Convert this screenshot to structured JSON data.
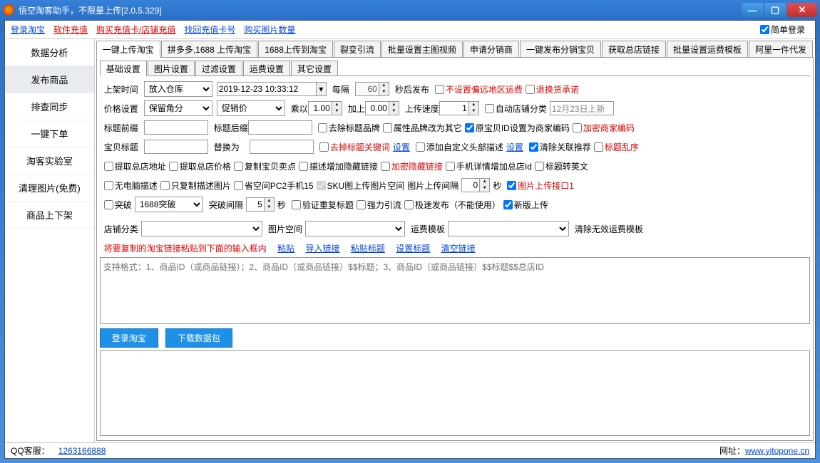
{
  "title": "悟空淘客助手，不限量上传[2.0.5.329]",
  "topbar": {
    "login_taobao": "登录淘宝",
    "soft_recharge": "软件充值",
    "buy_card": "购买充值卡/店铺充值",
    "find_card": "找回充值卡号",
    "buy_img_qty": "购买图片数量",
    "simple_login": "简单登录"
  },
  "sidebar": [
    "数据分析",
    "发布商品",
    "排查同步",
    "一键下单",
    "淘客实验室",
    "清理图片(免费)",
    "商品上下架"
  ],
  "tabs_outer": [
    "一键上传淘宝",
    "拼多多,1688 上传淘宝",
    "1688上传到淘宝",
    "裂变引流",
    "批量设置主图视频",
    "申请分销商",
    "一键发布分销宝贝",
    "获取总店链接",
    "批量设置运费模板",
    "阿里一件代发"
  ],
  "tabs_inner": [
    "基础设置",
    "图片设置",
    "过滤设置",
    "运费设置",
    "其它设置"
  ],
  "r1": {
    "shelf_time": "上架时间",
    "warehouse": "放入仓库",
    "dt": "2019-12-23 10:33:12",
    "interval": "每隔",
    "interval_v": "60",
    "sec_publish": "秒后发布",
    "no_remote_fee": "不设置偏远地区运费",
    "return_promise": "退换货承诺"
  },
  "r2": {
    "price_set": "价格设置",
    "keep_jiao": "保留角分",
    "promo": "促销价",
    "mul": "乘以",
    "mul_v": "1.00",
    "add": "加上",
    "add_v": "0.00",
    "speed": "上传速度",
    "speed_v": "1",
    "auto_cat": "自动店铺分类",
    "date_new": "12月23日上新"
  },
  "r3": {
    "prefix": "标题前缀",
    "suffix": "标题后缀",
    "rm_brand": "去除标题品牌",
    "attr_other": "属性品牌改为其它",
    "orig_id": "原宝贝ID设置为商家编码",
    "encrypt_code": "加密商家编码"
  },
  "r4": {
    "item_title": "宝贝标题",
    "replace": "替换为",
    "rm_kw": "去掉标题关键词",
    "set1": "设置",
    "add_head": "添加自定义头部描述",
    "set2": "设置",
    "clear_rec": "清除关联推荐",
    "title_shuffle": "标题乱序"
  },
  "r5": {
    "get_addr": "提取总店地址",
    "get_price": "提取总店价格",
    "copy_point": "复制宝贝卖点",
    "desc_hide": "描述增加隐藏链接",
    "encrypt_hide": "加密隐藏链接",
    "detail_total": "手机详情增加总店Id",
    "title_en": "标题转英文"
  },
  "r6": {
    "no_pc": "无电脑描述",
    "only_img": "只复制描述图片",
    "save_pc2": "省空间PC2手机15",
    "sku_img": "SKU图上传图片空间",
    "img_interval": "图片上传间隔",
    "img_iv": "0",
    "sec": "秒",
    "upload_if1": "图片上传接口1"
  },
  "r7": {
    "break": "突破",
    "break1688": "1688突破",
    "break_int": "突破间隔",
    "break_v": "5",
    "sec": "秒",
    "verify_dup": "验证重复标题",
    "strong": "强力引流",
    "fast_pub": "极速发布（不能使用）",
    "new_ver": "新版上传"
  },
  "r8": {
    "shop_cat": "店铺分类",
    "img_space": "图片空间",
    "fee_tpl": "运费模板",
    "clear_invalid": "清除无效运费模板"
  },
  "instr": {
    "text": "将要复制的淘宝链接粘贴到下面的输入框内",
    "paste": "粘贴",
    "import": "导入链接",
    "paste_title": "粘贴标题",
    "set_title": "设置标题",
    "clear": "清空链接"
  },
  "ta1_hint": "支持格式：1、商品ID（或商品链接）；2、商品ID（或商品链接）$$标题；3、商品ID（或商品链接）$$标题$$总店ID",
  "btns": {
    "login": "登录淘宝",
    "download": "下载数据包"
  },
  "status": {
    "qq": "QQ客服：",
    "qqnum": "1263166888",
    "siteLabel": "网址：",
    "site": "www.yitopone.cn"
  }
}
